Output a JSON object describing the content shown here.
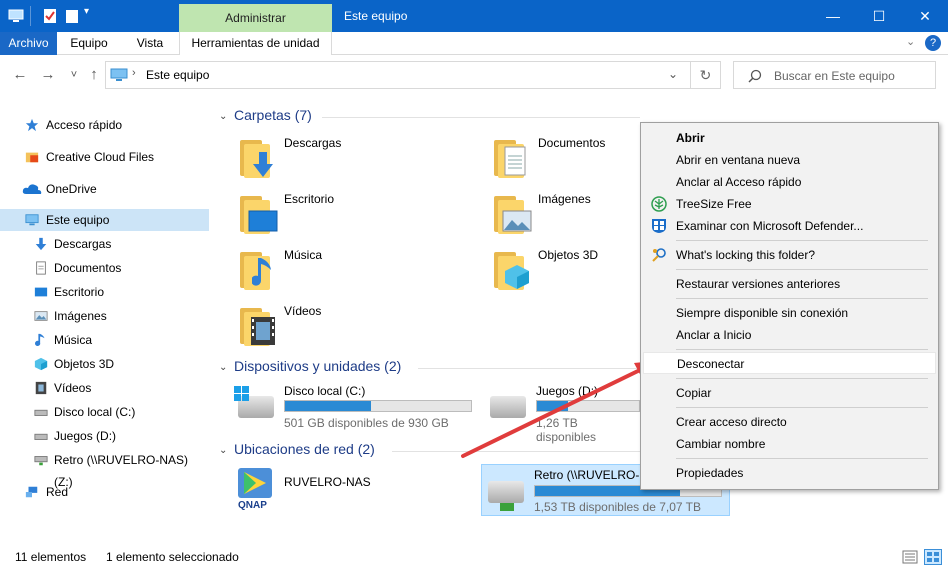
{
  "window": {
    "title": "Este equipo",
    "context_tab": "Administrar",
    "controls": {
      "minimize": "—",
      "maximize": "☐",
      "close": "✕"
    },
    "accent": "#0a64c8"
  },
  "ribbon": {
    "tabs": [
      "Archivo",
      "Equipo",
      "Vista",
      "Herramientas de unidad"
    ]
  },
  "nav": {
    "back": "←",
    "forward": "→",
    "recent": "˅",
    "up": "↑",
    "address": "Este equipo",
    "refresh": "↻",
    "search_placeholder": "Buscar en Este equipo"
  },
  "sidebar": {
    "items": [
      {
        "label": "Acceso rápido",
        "icon": "star-icon"
      },
      {
        "label": "Creative Cloud Files",
        "icon": "creative-cloud-icon"
      },
      {
        "label": "OneDrive",
        "icon": "cloud-icon"
      },
      {
        "label": "Este equipo",
        "icon": "computer-icon",
        "selected": true
      },
      {
        "label": "Descargas",
        "icon": "download-icon"
      },
      {
        "label": "Documentos",
        "icon": "document-icon"
      },
      {
        "label": "Escritorio",
        "icon": "desktop-icon"
      },
      {
        "label": "Imágenes",
        "icon": "image-icon"
      },
      {
        "label": "Música",
        "icon": "music-icon"
      },
      {
        "label": "Objetos 3D",
        "icon": "cube-icon"
      },
      {
        "label": "Vídeos",
        "icon": "video-icon"
      },
      {
        "label": "Disco local (C:)",
        "icon": "drive-icon"
      },
      {
        "label": "Juegos (D:)",
        "icon": "drive-icon"
      },
      {
        "label": "Retro (\\\\RUVELRO-NAS) (Z:)",
        "icon": "network-drive-icon"
      },
      {
        "label": "Red",
        "icon": "network-icon"
      }
    ]
  },
  "groups": {
    "folders": "Carpetas (7)",
    "devices": "Dispositivos y unidades (2)",
    "network": "Ubicaciones de red (2)"
  },
  "folders": [
    "Descargas",
    "Documentos",
    "Escritorio",
    "Imágenes",
    "Música",
    "Objetos 3D",
    "Vídeos"
  ],
  "drives": [
    {
      "name": "Disco local (C:)",
      "detail": "501 GB disponibles de 930 GB",
      "used_fraction": 0.46
    },
    {
      "name": "Juegos (D:)",
      "detail": "1,26 TB disponibles",
      "used_fraction": 0.3
    }
  ],
  "network_locations": [
    {
      "name": "RUVELRO-NAS",
      "logo_text": "QNAP"
    },
    {
      "name": "Retro (\\\\RUVELRO-",
      "detail": "1,53 TB disponibles de 7,07 TB",
      "used_fraction": 0.78,
      "selected": true
    }
  ],
  "context_menu": {
    "items": [
      {
        "label": "Abrir",
        "bold": true
      },
      {
        "label": "Abrir en ventana nueva"
      },
      {
        "label": "Anclar al Acceso rápido"
      },
      {
        "label": "TreeSize Free",
        "icon": "treesize-icon"
      },
      {
        "label": "Examinar con Microsoft Defender...",
        "icon": "defender-shield-icon"
      },
      {
        "label": "What's locking this folder?",
        "icon": "lock-search-icon"
      },
      {
        "label": "Restaurar versiones anteriores"
      },
      {
        "label": "Siempre disponible sin conexión"
      },
      {
        "label": "Anclar a Inicio"
      },
      {
        "label": "Desconectar",
        "highlighted": true
      },
      {
        "label": "Copiar"
      },
      {
        "label": "Crear acceso directo"
      },
      {
        "label": "Cambiar nombre"
      },
      {
        "label": "Propiedades"
      }
    ]
  },
  "status": {
    "count": "11 elementos",
    "selection": "1 elemento seleccionado"
  },
  "annotation_color": "#e03c3c"
}
